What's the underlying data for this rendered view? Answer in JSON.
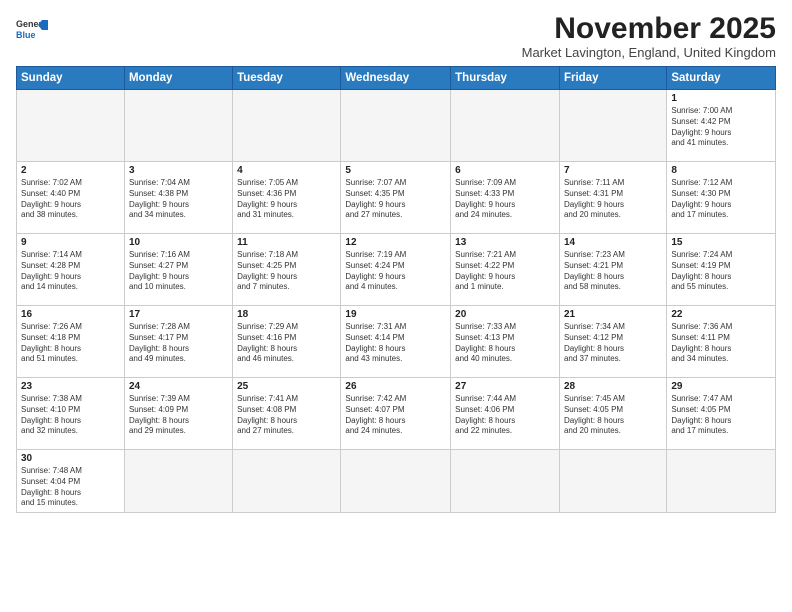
{
  "header": {
    "logo_line1": "General",
    "logo_line2": "Blue",
    "month_title": "November 2025",
    "subtitle": "Market Lavington, England, United Kingdom"
  },
  "days_of_week": [
    "Sunday",
    "Monday",
    "Tuesday",
    "Wednesday",
    "Thursday",
    "Friday",
    "Saturday"
  ],
  "weeks": [
    [
      {
        "num": "",
        "info": ""
      },
      {
        "num": "",
        "info": ""
      },
      {
        "num": "",
        "info": ""
      },
      {
        "num": "",
        "info": ""
      },
      {
        "num": "",
        "info": ""
      },
      {
        "num": "",
        "info": ""
      },
      {
        "num": "1",
        "info": "Sunrise: 7:00 AM\nSunset: 4:42 PM\nDaylight: 9 hours\nand 41 minutes."
      }
    ],
    [
      {
        "num": "2",
        "info": "Sunrise: 7:02 AM\nSunset: 4:40 PM\nDaylight: 9 hours\nand 38 minutes."
      },
      {
        "num": "3",
        "info": "Sunrise: 7:04 AM\nSunset: 4:38 PM\nDaylight: 9 hours\nand 34 minutes."
      },
      {
        "num": "4",
        "info": "Sunrise: 7:05 AM\nSunset: 4:36 PM\nDaylight: 9 hours\nand 31 minutes."
      },
      {
        "num": "5",
        "info": "Sunrise: 7:07 AM\nSunset: 4:35 PM\nDaylight: 9 hours\nand 27 minutes."
      },
      {
        "num": "6",
        "info": "Sunrise: 7:09 AM\nSunset: 4:33 PM\nDaylight: 9 hours\nand 24 minutes."
      },
      {
        "num": "7",
        "info": "Sunrise: 7:11 AM\nSunset: 4:31 PM\nDaylight: 9 hours\nand 20 minutes."
      },
      {
        "num": "8",
        "info": "Sunrise: 7:12 AM\nSunset: 4:30 PM\nDaylight: 9 hours\nand 17 minutes."
      }
    ],
    [
      {
        "num": "9",
        "info": "Sunrise: 7:14 AM\nSunset: 4:28 PM\nDaylight: 9 hours\nand 14 minutes."
      },
      {
        "num": "10",
        "info": "Sunrise: 7:16 AM\nSunset: 4:27 PM\nDaylight: 9 hours\nand 10 minutes."
      },
      {
        "num": "11",
        "info": "Sunrise: 7:18 AM\nSunset: 4:25 PM\nDaylight: 9 hours\nand 7 minutes."
      },
      {
        "num": "12",
        "info": "Sunrise: 7:19 AM\nSunset: 4:24 PM\nDaylight: 9 hours\nand 4 minutes."
      },
      {
        "num": "13",
        "info": "Sunrise: 7:21 AM\nSunset: 4:22 PM\nDaylight: 9 hours\nand 1 minute."
      },
      {
        "num": "14",
        "info": "Sunrise: 7:23 AM\nSunset: 4:21 PM\nDaylight: 8 hours\nand 58 minutes."
      },
      {
        "num": "15",
        "info": "Sunrise: 7:24 AM\nSunset: 4:19 PM\nDaylight: 8 hours\nand 55 minutes."
      }
    ],
    [
      {
        "num": "16",
        "info": "Sunrise: 7:26 AM\nSunset: 4:18 PM\nDaylight: 8 hours\nand 51 minutes."
      },
      {
        "num": "17",
        "info": "Sunrise: 7:28 AM\nSunset: 4:17 PM\nDaylight: 8 hours\nand 49 minutes."
      },
      {
        "num": "18",
        "info": "Sunrise: 7:29 AM\nSunset: 4:16 PM\nDaylight: 8 hours\nand 46 minutes."
      },
      {
        "num": "19",
        "info": "Sunrise: 7:31 AM\nSunset: 4:14 PM\nDaylight: 8 hours\nand 43 minutes."
      },
      {
        "num": "20",
        "info": "Sunrise: 7:33 AM\nSunset: 4:13 PM\nDaylight: 8 hours\nand 40 minutes."
      },
      {
        "num": "21",
        "info": "Sunrise: 7:34 AM\nSunset: 4:12 PM\nDaylight: 8 hours\nand 37 minutes."
      },
      {
        "num": "22",
        "info": "Sunrise: 7:36 AM\nSunset: 4:11 PM\nDaylight: 8 hours\nand 34 minutes."
      }
    ],
    [
      {
        "num": "23",
        "info": "Sunrise: 7:38 AM\nSunset: 4:10 PM\nDaylight: 8 hours\nand 32 minutes."
      },
      {
        "num": "24",
        "info": "Sunrise: 7:39 AM\nSunset: 4:09 PM\nDaylight: 8 hours\nand 29 minutes."
      },
      {
        "num": "25",
        "info": "Sunrise: 7:41 AM\nSunset: 4:08 PM\nDaylight: 8 hours\nand 27 minutes."
      },
      {
        "num": "26",
        "info": "Sunrise: 7:42 AM\nSunset: 4:07 PM\nDaylight: 8 hours\nand 24 minutes."
      },
      {
        "num": "27",
        "info": "Sunrise: 7:44 AM\nSunset: 4:06 PM\nDaylight: 8 hours\nand 22 minutes."
      },
      {
        "num": "28",
        "info": "Sunrise: 7:45 AM\nSunset: 4:05 PM\nDaylight: 8 hours\nand 20 minutes."
      },
      {
        "num": "29",
        "info": "Sunrise: 7:47 AM\nSunset: 4:05 PM\nDaylight: 8 hours\nand 17 minutes."
      }
    ],
    [
      {
        "num": "30",
        "info": "Sunrise: 7:48 AM\nSunset: 4:04 PM\nDaylight: 8 hours\nand 15 minutes."
      },
      {
        "num": "",
        "info": ""
      },
      {
        "num": "",
        "info": ""
      },
      {
        "num": "",
        "info": ""
      },
      {
        "num": "",
        "info": ""
      },
      {
        "num": "",
        "info": ""
      },
      {
        "num": "",
        "info": ""
      }
    ]
  ]
}
